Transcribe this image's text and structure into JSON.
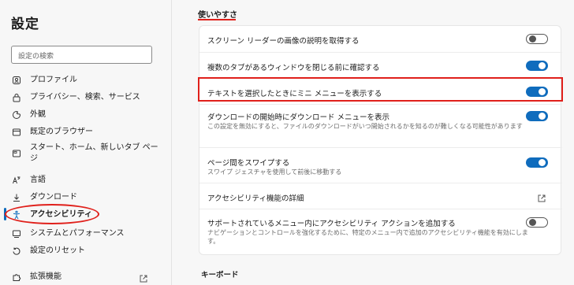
{
  "sidebar": {
    "title": "設定",
    "search_placeholder": "設定の検索",
    "items": [
      {
        "label": "プロファイル",
        "icon": "profile-icon"
      },
      {
        "label": "プライバシー、検索、サービス",
        "icon": "lock-icon"
      },
      {
        "label": "外観",
        "icon": "appearance-icon"
      },
      {
        "label": "既定のブラウザー",
        "icon": "browser-icon"
      },
      {
        "label": "スタート、ホーム、新しいタブ ページ",
        "icon": "home-tab-icon"
      },
      {
        "label": "言語",
        "icon": "language-icon"
      },
      {
        "label": "ダウンロード",
        "icon": "download-icon"
      },
      {
        "label": "アクセシビリティ",
        "icon": "accessibility-icon"
      },
      {
        "label": "システムとパフォーマンス",
        "icon": "system-icon"
      },
      {
        "label": "設定のリセット",
        "icon": "reset-icon"
      },
      {
        "label": "拡張機能",
        "icon": "extensions-icon"
      }
    ]
  },
  "main": {
    "section_title": "使いやすさ",
    "rows": [
      {
        "title": "スクリーン リーダーの画像の説明を取得する",
        "toggle": "off"
      },
      {
        "title": "複数のタブがあるウィンドウを閉じる前に確認する",
        "toggle": "on"
      },
      {
        "title": "テキストを選択したときにミニ メニューを表示する",
        "toggle": "on"
      },
      {
        "title": "ダウンロードの開始時にダウンロード メニューを表示",
        "desc": "この設定を無効にすると、ファイルのダウンロードがいつ開始されるかを知るのが難しくなる可能性があります",
        "toggle": "on"
      },
      {
        "title": "ページ間をスワイプする",
        "desc": "スワイプ ジェスチャを使用して前後に移動する",
        "toggle": "on"
      },
      {
        "title": "アクセシビリティ機能の詳細",
        "icon": "external-link-icon"
      },
      {
        "title": "サポートされているメニュー内にアクセシビリティ アクションを追加する",
        "desc": "ナビゲーションとコントロールを強化するために、特定のメニュー内で追加のアクセシビリティ機能を有効にします。",
        "toggle": "off"
      }
    ],
    "next_section_title": "キーボード"
  },
  "colors": {
    "accent": "#0f6cbd",
    "annotation_red": "#e0201b"
  }
}
